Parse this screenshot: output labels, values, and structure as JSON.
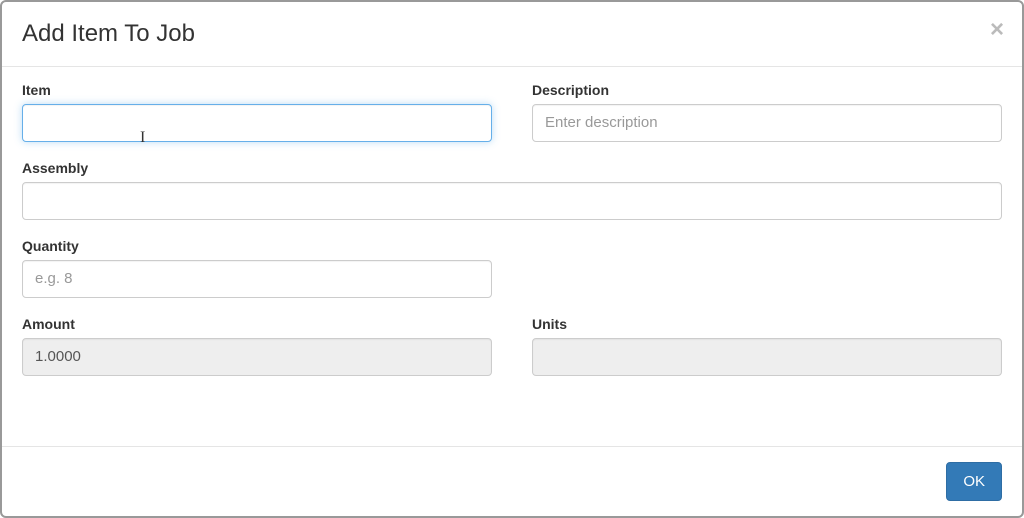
{
  "header": {
    "title": "Add Item To Job"
  },
  "fields": {
    "item": {
      "label": "Item",
      "value": "",
      "placeholder": ""
    },
    "description": {
      "label": "Description",
      "value": "",
      "placeholder": "Enter description"
    },
    "assembly": {
      "label": "Assembly",
      "value": "",
      "placeholder": ""
    },
    "quantity": {
      "label": "Quantity",
      "value": "",
      "placeholder": "e.g. 8"
    },
    "amount": {
      "label": "Amount",
      "value": "1.0000"
    },
    "units": {
      "label": "Units",
      "value": ""
    }
  },
  "footer": {
    "ok_label": "OK"
  }
}
